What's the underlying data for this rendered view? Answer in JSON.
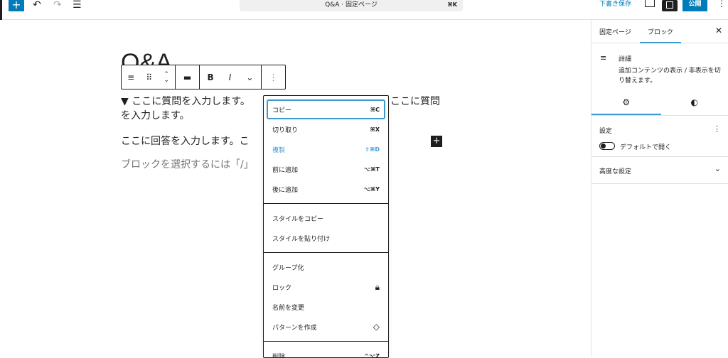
{
  "topbar": {
    "doc_title": "Q&A · 固定ページ",
    "shortcut": "⌘K",
    "save_draft": "下書き保存",
    "publish": "公開"
  },
  "editor": {
    "title": "Q&A",
    "summary_line1_a": "▼ ここに質問を入力します。",
    "summary_line1_b": "ここに質問",
    "summary_line2": "を入力します。",
    "answer": "ここに回答を入力します。こ",
    "placeholder": "ブロックを選択するには「/」"
  },
  "toolbar": {
    "bold": "B",
    "italic": "I"
  },
  "menu": {
    "group1": [
      {
        "label": "コピー",
        "key": "⌘C"
      },
      {
        "label": "切り取り",
        "key": "⌘X"
      },
      {
        "label": "複製",
        "key": "⇧⌘D"
      },
      {
        "label": "前に追加",
        "key": "⌥⌘T"
      },
      {
        "label": "後に追加",
        "key": "⌥⌘Y"
      }
    ],
    "group2": [
      {
        "label": "スタイルをコピー"
      },
      {
        "label": "スタイルを貼り付け"
      }
    ],
    "group3": [
      {
        "label": "グループ化"
      },
      {
        "label": "ロック",
        "icon": "lock-icon"
      },
      {
        "label": "名前を変更"
      },
      {
        "label": "パターンを作成",
        "icon": "pattern-icon"
      }
    ],
    "group4": [
      {
        "label": "削除",
        "key": "^⌥Z"
      }
    ]
  },
  "sidebar": {
    "tabs": [
      "固定ページ",
      "ブロック"
    ],
    "block_name": "詳細",
    "block_desc": "追加コンテンツの表示 / 非表示を切り替えます。",
    "settings_title": "設定",
    "toggle_label": "デフォルトで開く",
    "toggle_on": false,
    "advanced": "高度な設定"
  },
  "colors": {
    "accent": "#007cba",
    "highlight": "#3d9ad1"
  }
}
